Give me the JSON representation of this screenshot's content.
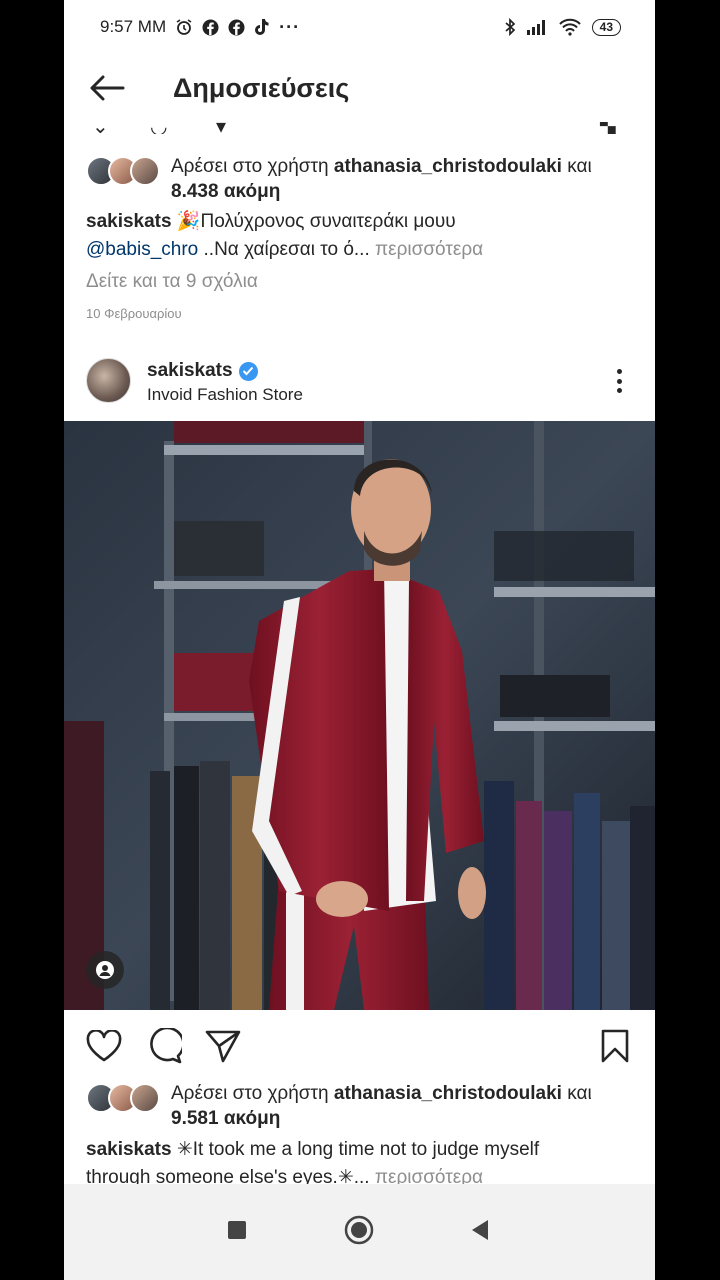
{
  "status_bar": {
    "time": "9:57 MM",
    "battery": "43"
  },
  "header": {
    "title": "Δημοσιεύσεις"
  },
  "post1": {
    "likes_prefix": "Αρέσει στο χρήστη",
    "likes_user": "athanasia_christodoulaki",
    "likes_conj": "και",
    "likes_count": "8.438 ακόμη",
    "caption_user": "sakiskats",
    "caption_line1": "🎉Πολύχρονος συναιτεράκι μουυ",
    "caption_mention": "@babis_chro",
    "caption_line2": "..Να χαίρεσαι το ό...",
    "more_label": "περισσότερα",
    "view_comments": "Δείτε και τα 9 σχόλια",
    "date": "10 Φεβρουαρίου"
  },
  "post2": {
    "username": "sakiskats",
    "location": "Invoid Fashion Store",
    "likes_prefix": "Αρέσει στο χρήστη",
    "likes_user": "athanasia_christodoulaki",
    "likes_conj": "και",
    "likes_count": "9.581 ακόμη",
    "caption_user": "sakiskats",
    "caption_line1": "✳It took me a long time not to judge myself",
    "caption_line2": "through someone else's eyes.✳...",
    "more_label": "περισσότερα"
  },
  "colors": {
    "text": "#262626",
    "muted": "#8e8e8e",
    "link": "#00376b",
    "verified": "#3897f0",
    "jacket": "#8b1d2c"
  },
  "icons": {
    "back": "arrow-left-icon",
    "like": "heart-icon",
    "comment": "speech-bubble-icon",
    "share": "paper-plane-icon",
    "save": "bookmark-icon",
    "menu": "more-vertical-icon",
    "tag": "person-tag-icon"
  }
}
